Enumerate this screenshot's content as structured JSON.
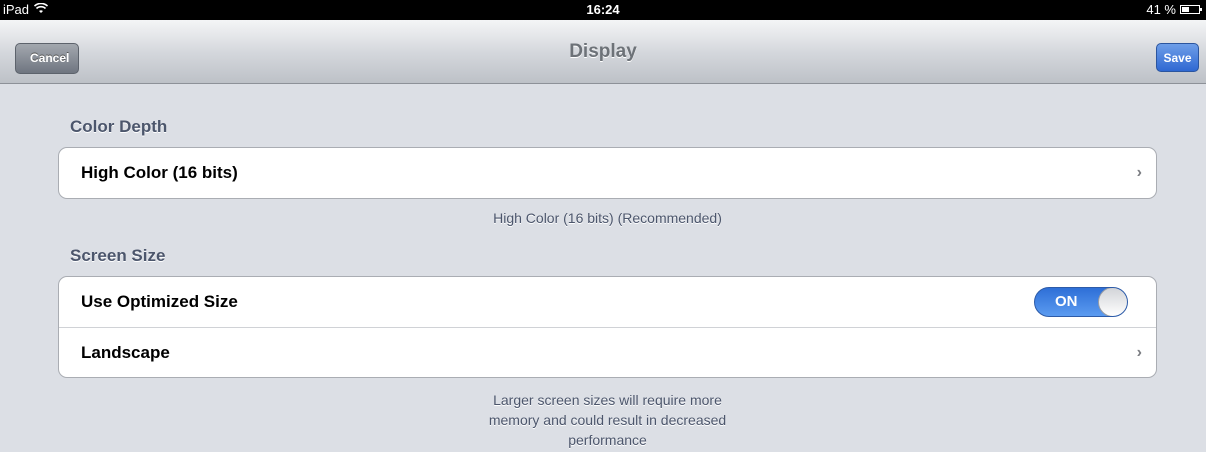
{
  "status_bar": {
    "device": "iPad",
    "time": "16:24",
    "battery": "41 %"
  },
  "nav": {
    "title": "Display",
    "cancel_label": "Cancel",
    "save_label": "Save"
  },
  "color_depth": {
    "header": "Color Depth",
    "value_label": "High Color (16 bits)",
    "footer": "High Color (16 bits) (Recommended)"
  },
  "screen_size": {
    "header": "Screen Size",
    "optimized_label": "Use Optimized Size",
    "optimized_toggle": "ON",
    "orientation_label": "Landscape",
    "footer_line1": "Larger screen sizes will require more",
    "footer_line2": "memory and could result in decreased",
    "footer_line3": "performance"
  },
  "colors": {
    "nav_title": "#6d7278",
    "save_button": "#2f68d2",
    "toggle_on": "#2e6fd7",
    "background": "#dcdfe5"
  },
  "icons": [
    "wifi-icon",
    "battery-icon",
    "chevron-right-icon"
  ]
}
